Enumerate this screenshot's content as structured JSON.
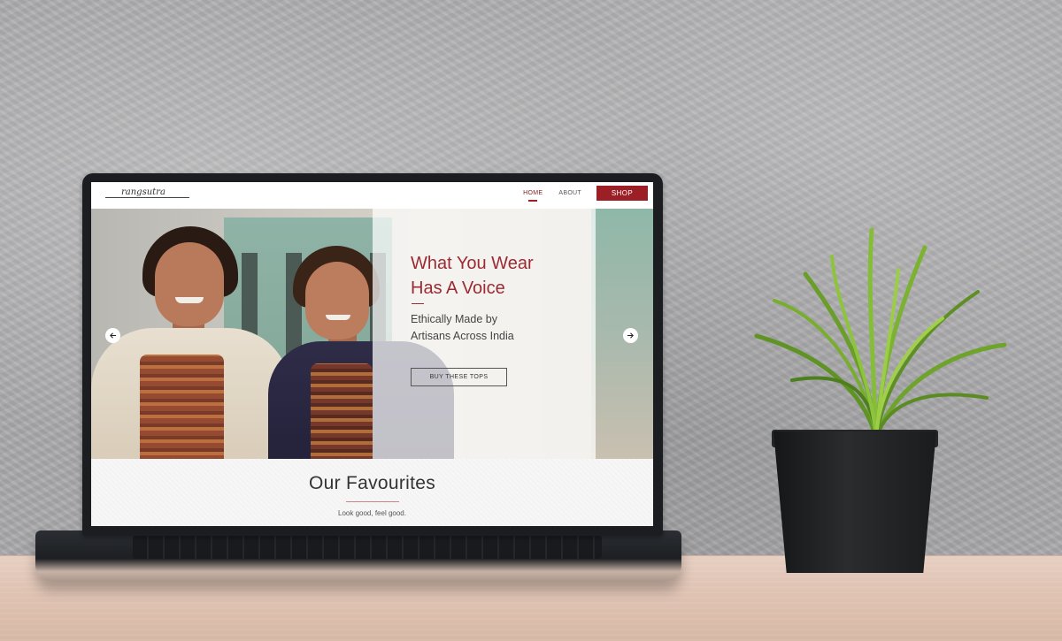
{
  "site": {
    "logo_text": "rangsutra",
    "nav": {
      "home": "HOME",
      "about": "ABOUT",
      "shop": "SHOP"
    }
  },
  "hero": {
    "title_line1": "What You Wear",
    "title_line2": "Has A Voice",
    "subtitle_line1": "Ethically Made by",
    "subtitle_line2": "Artisans Across India",
    "cta": "BUY THESE TOPS",
    "prev_icon": "arrow-left-icon",
    "next_icon": "arrow-right-icon"
  },
  "favourites": {
    "title": "Our Favourites",
    "subtitle": "Look good, feel good."
  },
  "colors": {
    "brand_red": "#9c1f26",
    "title_red": "#9c2a32"
  }
}
